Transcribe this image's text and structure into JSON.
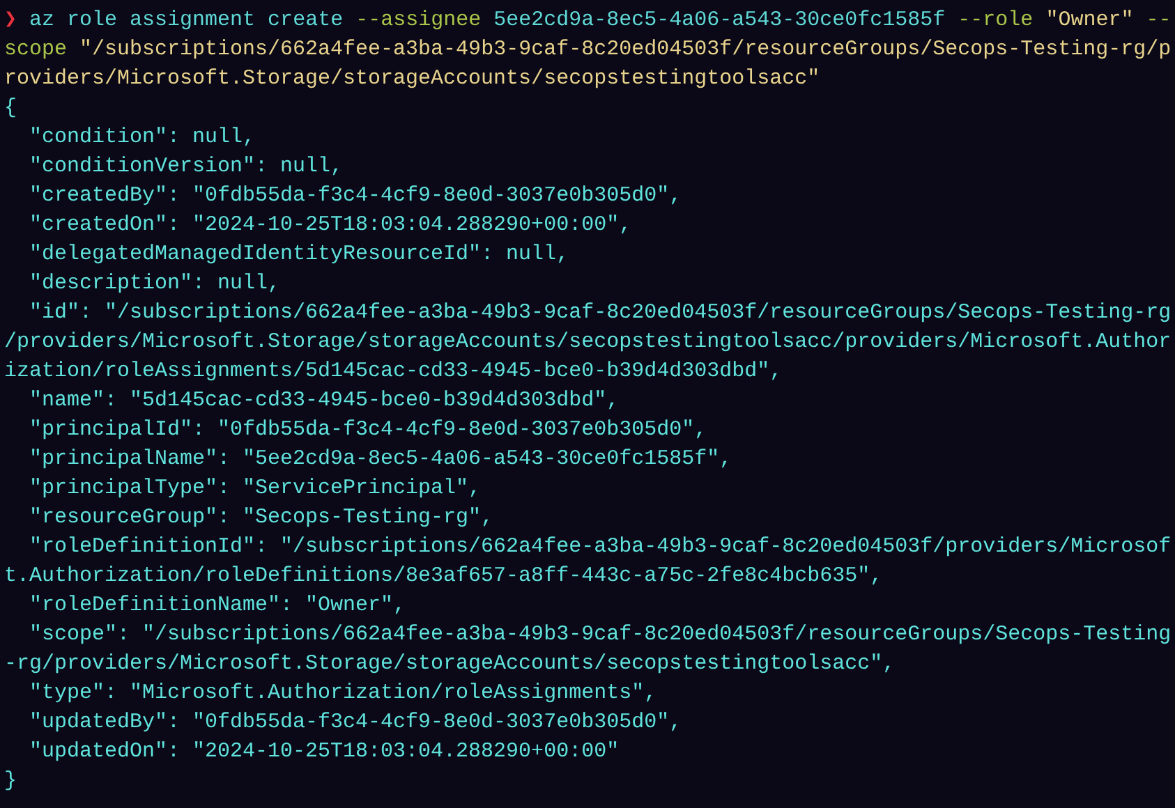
{
  "terminal": {
    "lines": [
      {
        "segments": [
          {
            "kind": "prompt",
            "text": "❯"
          },
          {
            "kind": "command",
            "text": " az role assignment create "
          },
          {
            "kind": "flag",
            "text": "--assignee "
          },
          {
            "kind": "command",
            "text": "5ee2cd9a-8ec5-4a06-a543-30ce0fc1585f "
          },
          {
            "kind": "flag",
            "text": "--role "
          },
          {
            "kind": "string",
            "text": "\"Owner\" "
          },
          {
            "kind": "flag",
            "text": "--"
          }
        ]
      },
      {
        "segments": [
          {
            "kind": "flag",
            "text": "scope "
          },
          {
            "kind": "string",
            "text": "\"/subscriptions/662a4fee-a3ba-49b3-9caf-8c20ed04503f/resourceGroups/Secops-Testing-rg/p"
          }
        ]
      },
      {
        "segments": [
          {
            "kind": "string",
            "text": "roviders/Microsoft.Storage/storageAccounts/secopstestingtoolsacc\""
          }
        ]
      },
      {
        "segments": [
          {
            "kind": "output",
            "text": "{"
          }
        ]
      },
      {
        "segments": [
          {
            "kind": "output",
            "text": "  \"condition\": null,"
          }
        ]
      },
      {
        "segments": [
          {
            "kind": "output",
            "text": "  \"conditionVersion\": null,"
          }
        ]
      },
      {
        "segments": [
          {
            "kind": "output",
            "text": "  \"createdBy\": \"0fdb55da-f3c4-4cf9-8e0d-3037e0b305d0\","
          }
        ]
      },
      {
        "segments": [
          {
            "kind": "output",
            "text": "  \"createdOn\": \"2024-10-25T18:03:04.288290+00:00\","
          }
        ]
      },
      {
        "segments": [
          {
            "kind": "output",
            "text": "  \"delegatedManagedIdentityResourceId\": null,"
          }
        ]
      },
      {
        "segments": [
          {
            "kind": "output",
            "text": "  \"description\": null,"
          }
        ]
      },
      {
        "segments": [
          {
            "kind": "output",
            "text": "  \"id\": \"/subscriptions/662a4fee-a3ba-49b3-9caf-8c20ed04503f/resourceGroups/Secops-Testing-rg"
          }
        ]
      },
      {
        "segments": [
          {
            "kind": "output",
            "text": "/providers/Microsoft.Storage/storageAccounts/secopstestingtoolsacc/providers/Microsoft.Author"
          }
        ]
      },
      {
        "segments": [
          {
            "kind": "output",
            "text": "ization/roleAssignments/5d145cac-cd33-4945-bce0-b39d4d303dbd\","
          }
        ]
      },
      {
        "segments": [
          {
            "kind": "output",
            "text": "  \"name\": \"5d145cac-cd33-4945-bce0-b39d4d303dbd\","
          }
        ]
      },
      {
        "segments": [
          {
            "kind": "output",
            "text": "  \"principalId\": \"0fdb55da-f3c4-4cf9-8e0d-3037e0b305d0\","
          }
        ]
      },
      {
        "segments": [
          {
            "kind": "output",
            "text": "  \"principalName\": \"5ee2cd9a-8ec5-4a06-a543-30ce0fc1585f\","
          }
        ]
      },
      {
        "segments": [
          {
            "kind": "output",
            "text": "  \"principalType\": \"ServicePrincipal\","
          }
        ]
      },
      {
        "segments": [
          {
            "kind": "output",
            "text": "  \"resourceGroup\": \"Secops-Testing-rg\","
          }
        ]
      },
      {
        "segments": [
          {
            "kind": "output",
            "text": "  \"roleDefinitionId\": \"/subscriptions/662a4fee-a3ba-49b3-9caf-8c20ed04503f/providers/Microsof"
          }
        ]
      },
      {
        "segments": [
          {
            "kind": "output",
            "text": "t.Authorization/roleDefinitions/8e3af657-a8ff-443c-a75c-2fe8c4bcb635\","
          }
        ]
      },
      {
        "segments": [
          {
            "kind": "output",
            "text": "  \"roleDefinitionName\": \"Owner\","
          }
        ]
      },
      {
        "segments": [
          {
            "kind": "output",
            "text": "  \"scope\": \"/subscriptions/662a4fee-a3ba-49b3-9caf-8c20ed04503f/resourceGroups/Secops-Testing"
          }
        ]
      },
      {
        "segments": [
          {
            "kind": "output",
            "text": "-rg/providers/Microsoft.Storage/storageAccounts/secopstestingtoolsacc\","
          }
        ]
      },
      {
        "segments": [
          {
            "kind": "output",
            "text": "  \"type\": \"Microsoft.Authorization/roleAssignments\","
          }
        ]
      },
      {
        "segments": [
          {
            "kind": "output",
            "text": "  \"updatedBy\": \"0fdb55da-f3c4-4cf9-8e0d-3037e0b305d0\","
          }
        ]
      },
      {
        "segments": [
          {
            "kind": "output",
            "text": "  \"updatedOn\": \"2024-10-25T18:03:04.288290+00:00\""
          }
        ]
      },
      {
        "segments": [
          {
            "kind": "output",
            "text": "}"
          }
        ]
      }
    ]
  }
}
